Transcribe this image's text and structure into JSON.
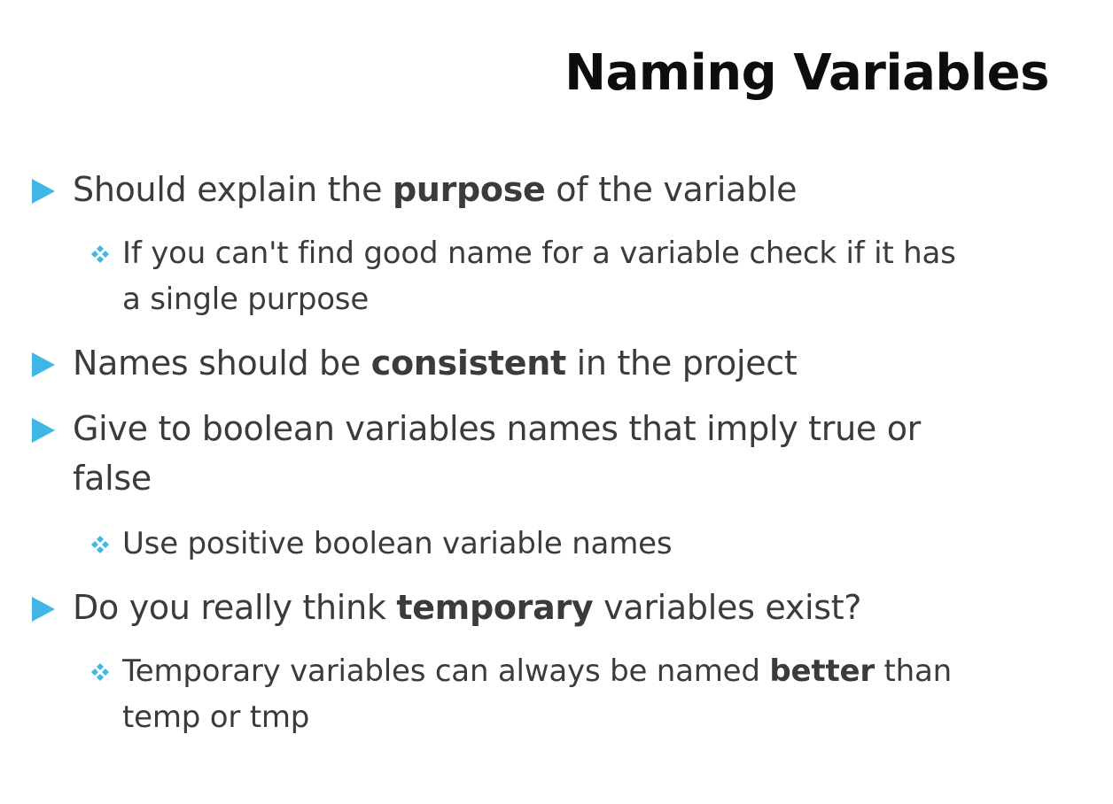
{
  "slide": {
    "title": "Naming Variables",
    "bullets": [
      {
        "pre": "Should explain the ",
        "bold": "purpose",
        "post": " of the variable",
        "subs": [
          {
            "line1": "If you can't find good name for a variable check if it has",
            "line2": "a single purpose"
          }
        ]
      },
      {
        "pre": "Names should be ",
        "bold": "consistent",
        "post": " in the project"
      },
      {
        "line1": "Give to boolean variables names that imply true or",
        "line2": "false",
        "subs": [
          {
            "line1": "Use positive boolean variable names"
          }
        ]
      },
      {
        "pre": "Do you really think ",
        "bold": "temporary",
        "post": " variables exist?",
        "subs": [
          {
            "pre": "Temporary variables can always be named ",
            "bold": "better",
            "post": " than",
            "line2": "temp or tmp"
          }
        ]
      }
    ],
    "accent_color": "#3fb6e6",
    "bullet_icon": "triangle-bullet-icon",
    "sub_bullet_icon": "four-diamond-bullet-icon"
  }
}
